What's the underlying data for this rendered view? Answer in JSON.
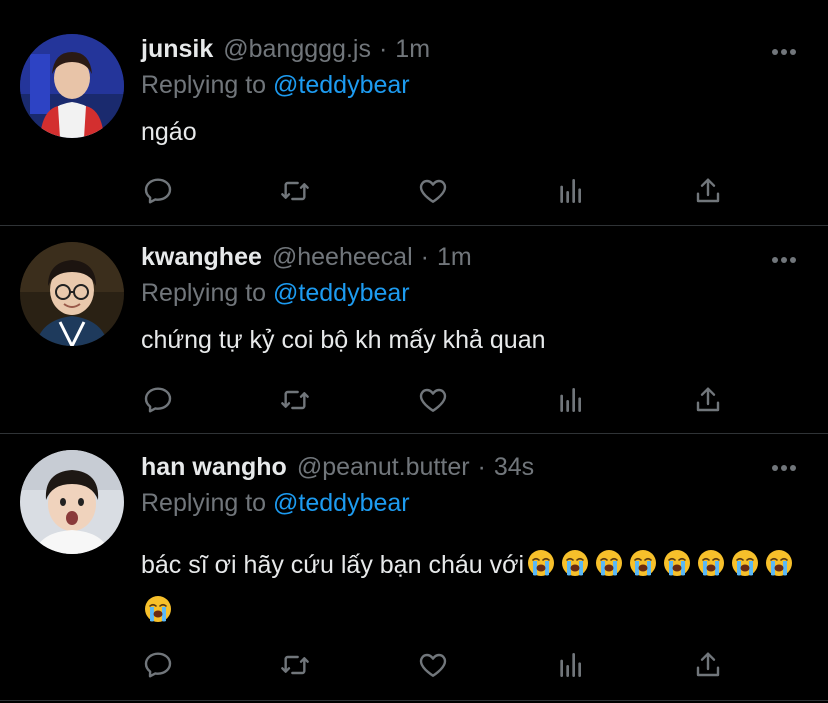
{
  "tweets": [
    {
      "display_name": "junsik",
      "handle": "@bangggg.js",
      "separator": "·",
      "time": "1m",
      "replying_prefix": "Replying to",
      "replying_to": "@teddybear",
      "text": "ngáo"
    },
    {
      "display_name": "kwanghee",
      "handle": "@heeheecal",
      "separator": "·",
      "time": "1m",
      "replying_prefix": "Replying to",
      "replying_to": "@teddybear",
      "text": "chứng tự kỷ coi bộ kh mấy khả quan"
    },
    {
      "display_name": "han wangho",
      "handle": "@peanut.butter",
      "separator": "·",
      "time": "34s",
      "replying_prefix": "Replying to",
      "replying_to": "@teddybear",
      "text": "bác sĩ ơi hãy cứu lấy bạn cháu với",
      "emoji_count": 9
    }
  ],
  "icons": {
    "more": "more-icon",
    "reply": "reply-icon",
    "retweet": "retweet-icon",
    "like": "heart-icon",
    "analytics": "analytics-icon",
    "share": "share-icon",
    "emoji": "loudly-crying-face-emoji"
  },
  "colors": {
    "background": "#000000",
    "text": "#e7e9ea",
    "secondary": "#71767b",
    "accent": "#1d9bf0",
    "divider": "#2f3336"
  }
}
